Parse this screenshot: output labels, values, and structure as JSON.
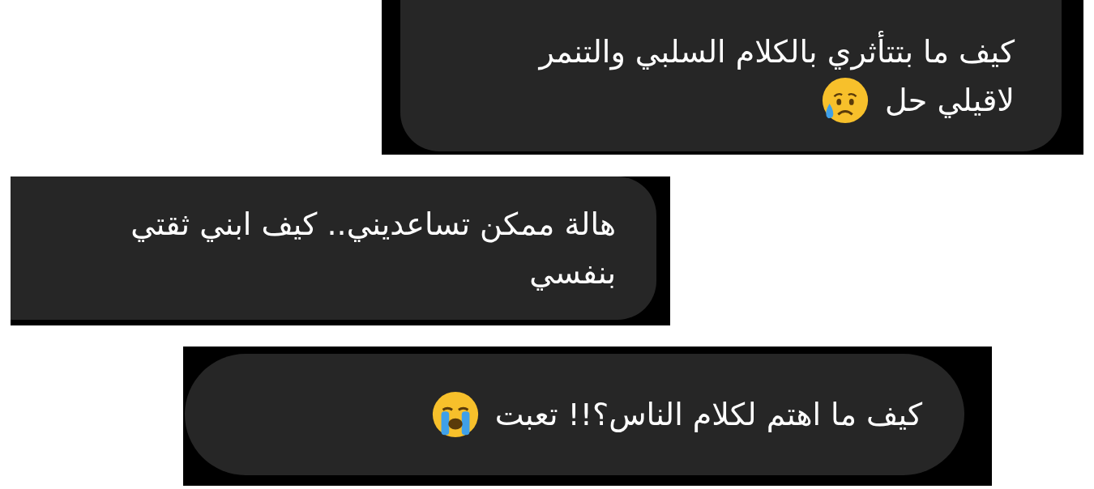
{
  "messages": [
    {
      "lines": [
        "كيف ما بتتأثري بالكلام السلبي والتنمر",
        "لاقيلي حل"
      ],
      "kind": "sad"
    },
    {
      "lines": [
        "هالة ممكن تساعديني.. كيف ابني ثقتي",
        "بنفسي"
      ]
    },
    {
      "lines": [
        "كيف ما اهتم لكلام الناس؟!! تعبت"
      ],
      "kind": "crying"
    }
  ]
}
